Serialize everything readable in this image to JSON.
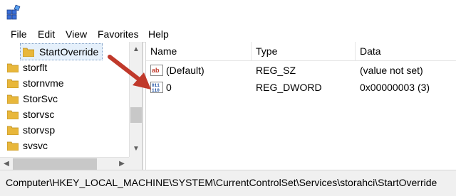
{
  "menu": [
    "File",
    "Edit",
    "View",
    "Favorites",
    "Help"
  ],
  "tree": {
    "selected": "StartOverride",
    "items": [
      "storflt",
      "stornvme",
      "StorSvc",
      "storvsc",
      "storvsp",
      "svsvc"
    ]
  },
  "list": {
    "columns": [
      "Name",
      "Type",
      "Data"
    ],
    "rows": [
      {
        "icon": "string-value-icon",
        "name": "(Default)",
        "type": "REG_SZ",
        "data": "(value not set)"
      },
      {
        "icon": "dword-value-icon",
        "name": "0",
        "type": "REG_DWORD",
        "data": "0x00000003 (3)"
      }
    ]
  },
  "status": {
    "path": "Computer\\HKEY_LOCAL_MACHINE\\SYSTEM\\CurrentControlSet\\Services\\storahci\\StartOverride"
  },
  "colors": {
    "annotation_arrow": "#c0392b",
    "folder": "#e8b73b"
  }
}
